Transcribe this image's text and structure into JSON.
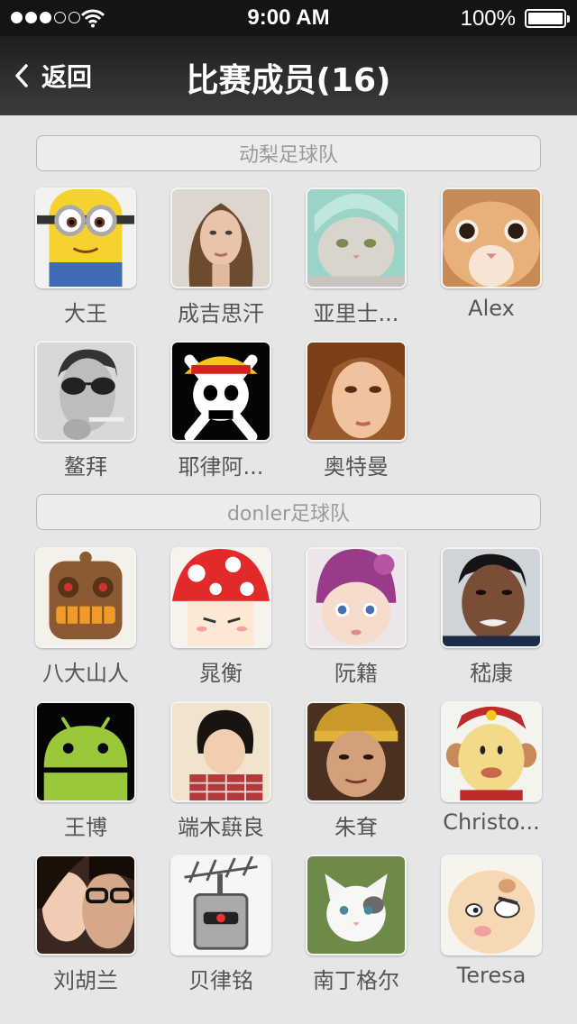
{
  "status": {
    "time": "9:00 AM",
    "battery": "100%"
  },
  "nav": {
    "back_label": "返回",
    "title": "比赛成员(16)"
  },
  "teams": [
    {
      "name": "动梨足球队",
      "members": [
        {
          "name": "大王",
          "avatar": "minion"
        },
        {
          "name": "成吉思汗",
          "avatar": "woman-portrait"
        },
        {
          "name": "亚里士...",
          "avatar": "cat-towel"
        },
        {
          "name": "Alex",
          "avatar": "kitten-face"
        },
        {
          "name": "鳌拜",
          "avatar": "man-sunglasses"
        },
        {
          "name": "耶律阿...",
          "avatar": "jolly-roger"
        },
        {
          "name": "奥特曼",
          "avatar": "girl-portrait"
        }
      ]
    },
    {
      "name": "donler足球队",
      "members": [
        {
          "name": "八大山人",
          "avatar": "robot-cartoon"
        },
        {
          "name": "晁衡",
          "avatar": "mushroom-cartoon"
        },
        {
          "name": "阮籍",
          "avatar": "baby-knit-hat"
        },
        {
          "name": "嵇康",
          "avatar": "man-portrait"
        },
        {
          "name": "王博",
          "avatar": "android"
        },
        {
          "name": "端木蕻良",
          "avatar": "child-plaid"
        },
        {
          "name": "朱耷",
          "avatar": "man-costume"
        },
        {
          "name": "Christo...",
          "avatar": "monkey-cartoon"
        },
        {
          "name": "刘胡兰",
          "avatar": "couple-photo"
        },
        {
          "name": "贝律铭",
          "avatar": "robot-antenna"
        },
        {
          "name": "南丁格尔",
          "avatar": "kitten-white"
        },
        {
          "name": "Teresa",
          "avatar": "angry-bun"
        }
      ]
    }
  ]
}
